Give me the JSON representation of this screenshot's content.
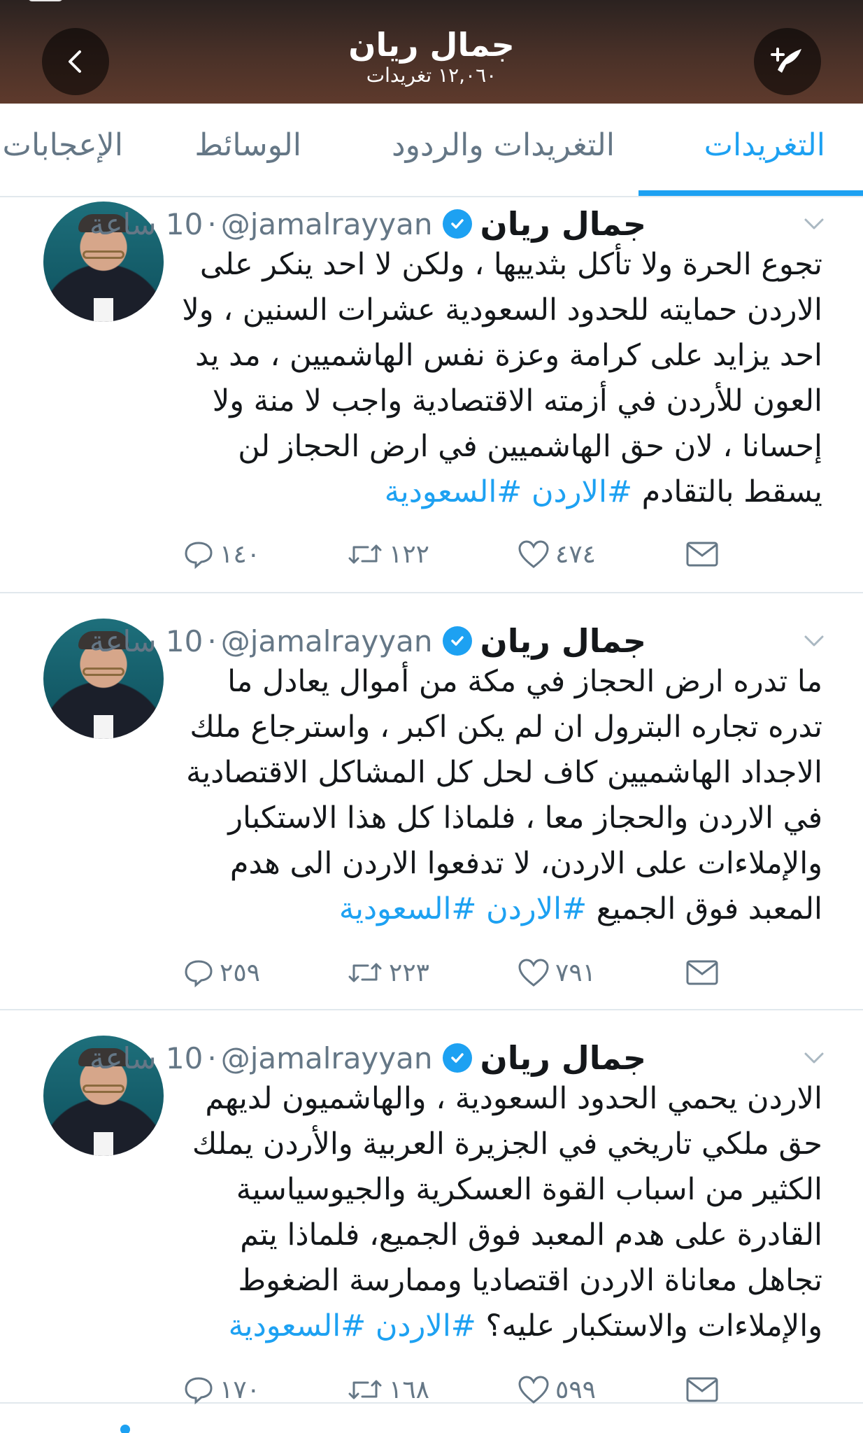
{
  "header": {
    "title": "جمال ريان",
    "subtitle": "١٢,٠٦٠ تغريدات",
    "back_icon": "chevron-left-icon",
    "compose_icon": "compose-tweet-icon"
  },
  "tabs": [
    {
      "label": "التغريدات",
      "active": true
    },
    {
      "label": "التغريدات والردود",
      "active": false
    },
    {
      "label": "الوسائط",
      "active": false
    },
    {
      "label": "الإعجابات",
      "active": false
    }
  ],
  "colors": {
    "accent": "#1da1f2",
    "muted": "#657786",
    "text": "#14171a"
  },
  "tweets": [
    {
      "name": "جمال ريان",
      "handle": "@jamalrayyan",
      "time": "10 ساعة",
      "text": "تجوع الحرة ولا تأكل بثدييها ، ولكن لا احد ينكر على\nالاردن حمايته للحدود السعودية عشرات السنين ، ولا\nاحد يزايد على كرامة وعزة نفس الهاشميين ، مد يد\nالعون للأردن في أزمته الاقتصادية واجب لا منة ولا\nإحسانا ، لان حق الهاشميين في ارض الحجاز لن\nيسقط بالتقادم ",
      "hashtags": "#الاردن #السعودية",
      "replies": "١٤٠",
      "retweets": "١٢٢",
      "likes": "٤٧٤"
    },
    {
      "name": "جمال ريان",
      "handle": "@jamalrayyan",
      "time": "10 ساعة",
      "text": "ما تدره ارض الحجاز في مكة من أموال يعادل ما\nتدره تجاره البترول ان لم يكن اكبر ، واسترجاع ملك\nالاجداد الهاشميين كاف لحل كل المشاكل الاقتصادية\nفي الاردن والحجاز معا ، فلماذا كل هذا الاستكبار\nوالإملاءات على الاردن، لا تدفعوا الاردن الى هدم\nالمعبد فوق الجميع ",
      "hashtags": "#الاردن #السعودية",
      "replies": "٢٥٩",
      "retweets": "٢٢٣",
      "likes": "٧٩١"
    },
    {
      "name": "جمال ريان",
      "handle": "@jamalrayyan",
      "time": "10 ساعة",
      "text": "الاردن يحمي الحدود السعودية ، والهاشميون لديهم\nحق ملكي تاريخي في الجزيرة العربية والأردن يملك\nالكثير من اسباب القوة العسكرية والجيوسياسية\nالقادرة على هدم المعبد فوق الجميع، فلماذا يتم\nتجاهل معاناة الاردن اقتصاديا وممارسة الضغوط\nوالإملاءات والاستكبار عليه؟ ",
      "hashtags": "#الاردن #السعودية",
      "replies": "١٧٠",
      "retweets": "١٦٨",
      "likes": "٥٩٩"
    }
  ]
}
